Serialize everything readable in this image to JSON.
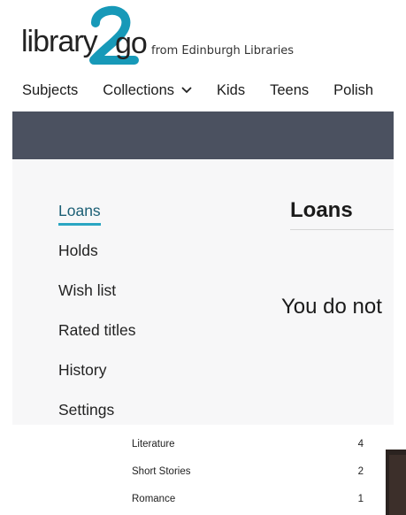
{
  "logo": {
    "left_text": "library",
    "digit": "2",
    "right_text": "go",
    "subtitle": "from Edinburgh Libraries",
    "accent_color": "#1799b8"
  },
  "nav": {
    "items": [
      {
        "label": "Subjects"
      },
      {
        "label": "Collections",
        "icon": "chevron-down-icon"
      },
      {
        "label": "Kids"
      },
      {
        "label": "Teens"
      },
      {
        "label": "Polish"
      }
    ]
  },
  "banner": {
    "color": "#4b5160"
  },
  "account": {
    "sidebar": [
      {
        "label": "Loans",
        "active": true
      },
      {
        "label": "Holds"
      },
      {
        "label": "Wish list"
      },
      {
        "label": "Rated titles"
      },
      {
        "label": "History"
      },
      {
        "label": "Settings"
      }
    ],
    "title": "Loans",
    "empty_message": "You do not"
  },
  "subjects": [
    {
      "name": "Literature",
      "count": "4"
    },
    {
      "name": "Short Stories",
      "count": "2"
    },
    {
      "name": "Romance",
      "count": "1"
    }
  ]
}
